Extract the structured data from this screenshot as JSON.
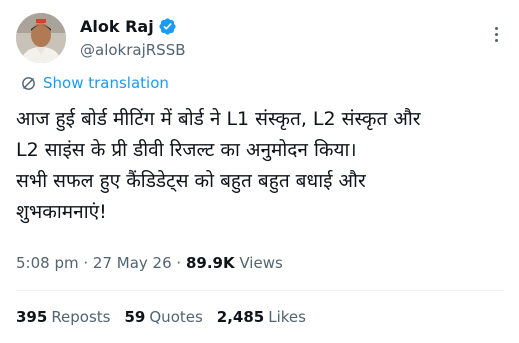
{
  "author": {
    "display_name": "Alok Raj",
    "handle": "@alokrajRSSB",
    "verified": true
  },
  "translation_link": "Show translation",
  "tweet": {
    "lines": [
      "आज हुई बोर्ड मीटिंग में बोर्ड ने L1 संस्कृत, L2 संस्कृत और",
      "L2 साइंस के प्री डीवी रिजल्ट का अनुमोदन किया।",
      "सभी सफल हुए कैंडिडेट्स को बहुत बहुत बधाई और",
      "शुभकामनाएं!"
    ]
  },
  "meta": {
    "time": "5:08 pm",
    "sep1": " · ",
    "date": "27 May 26",
    "sep2": " · ",
    "views_count": "89.9K",
    "views_label": " Views"
  },
  "stats": {
    "reposts_count": "395",
    "reposts_label": "Reposts",
    "quotes_count": "59",
    "quotes_label": "Quotes",
    "likes_count": "2,485",
    "likes_label": "Likes"
  },
  "colors": {
    "accent": "#1d9bf0",
    "text_primary": "#0f1419",
    "text_secondary": "#536471"
  },
  "icons": {
    "verified": "verified-badge-icon",
    "more": "more-options-icon",
    "translate": "globe-translate-icon"
  }
}
